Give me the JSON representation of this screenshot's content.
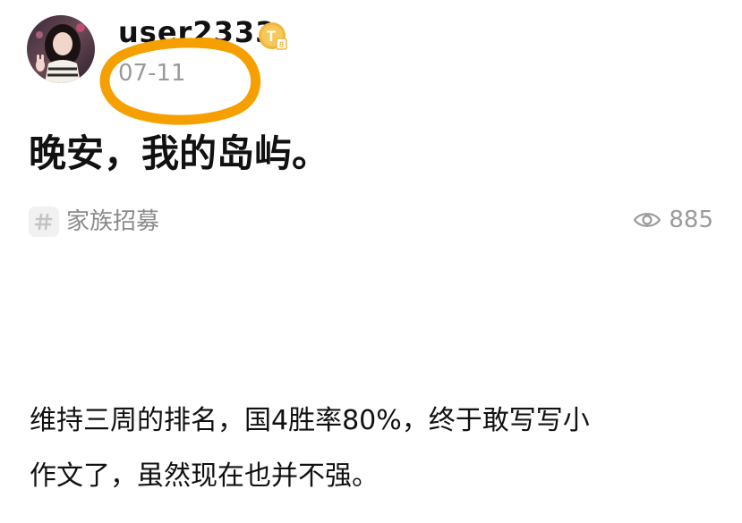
{
  "author": {
    "username": "user2333",
    "badge_letter": "T",
    "badge_sub": "8"
  },
  "post": {
    "date": "07-11",
    "title": "晚安，我的岛屿。",
    "tag": "家族招募",
    "views": "885",
    "body_lines": [
      "维持三周的排名，国4胜率80%，终于敢写写小",
      "作文了，虽然现在也并不强。"
    ]
  },
  "icons": {
    "tag": "hashtag-icon",
    "views": "eye-icon",
    "badge": "level-badge-icon"
  },
  "colors": {
    "annotation": "#f5a000",
    "badge": "#f3b53a",
    "muted_text": "#9a9a9a",
    "text": "#111111"
  }
}
